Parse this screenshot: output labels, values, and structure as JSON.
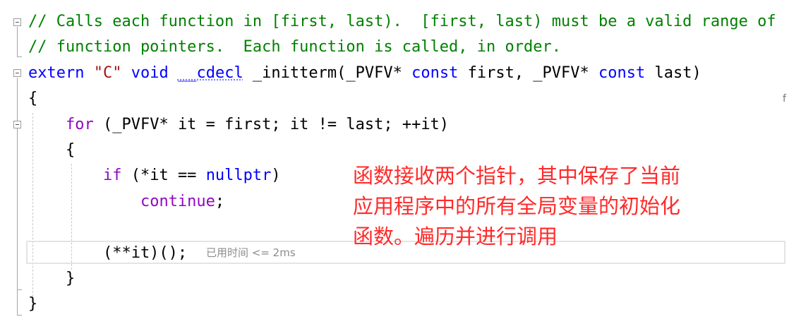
{
  "editor": {
    "lines": {
      "l1": "// Calls each function in [first, last).  [first, last) must be a valid range of",
      "l2": "// function pointers.  Each function is called, in order.",
      "l3_extern": "extern",
      "l3_space1": " ",
      "l3_c": "\"C\"",
      "l3_space2": " ",
      "l3_void": "void",
      "l3_space3": " ",
      "l3_cdecl": "__cdecl",
      "l3_rest1": " _initterm(_PVFV* ",
      "l3_const1": "const",
      "l3_rest2": " first, _PVFV* ",
      "l3_const2": "const",
      "l3_rest3": " last)",
      "l4": "{",
      "l5_indent": "    ",
      "l5_for": "for",
      "l5_rest": " (_PVFV* it = first; it != last; ++it)",
      "l6": "    {",
      "l7_indent": "        ",
      "l7_if": "if",
      "l7_mid": " (*it == ",
      "l7_nullptr": "nullptr",
      "l7_end": ")",
      "l8_indent": "            ",
      "l8_continue": "continue",
      "l8_end": ";",
      "l10": "        (**it)();",
      "l11": "    }",
      "l12": "}"
    },
    "perf_tip": "已用时间 <= 2ms",
    "right_marker": "f"
  },
  "annotation": {
    "line1": "函数接收两个指针，其中保存了当前",
    "line2": "应用程序中的所有全局变量的初始化",
    "line3": "函数。遍历并进行调用"
  },
  "colors": {
    "comment": "#008000",
    "keyword": "#0000ff",
    "string": "#a31515",
    "control": "#8f08c4",
    "annotation": "#ff2a2a"
  }
}
